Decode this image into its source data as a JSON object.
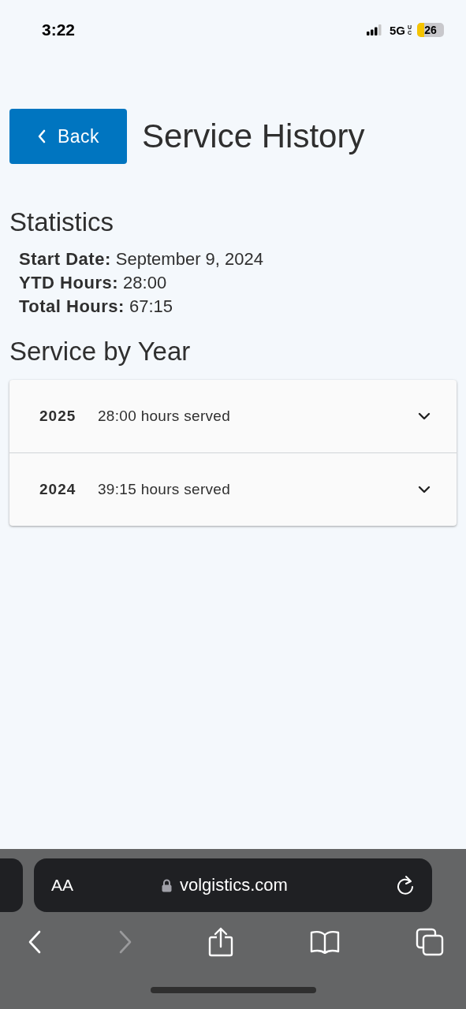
{
  "status_bar": {
    "time": "3:22",
    "network": "5G",
    "network_badge": "UC",
    "battery": "26"
  },
  "header": {
    "back_button": "Back",
    "title": "Service History"
  },
  "statistics": {
    "heading": "Statistics",
    "items": [
      {
        "label": "Start Date:",
        "value": "September 9, 2024"
      },
      {
        "label": "YTD Hours:",
        "value": "28:00"
      },
      {
        "label": "Total Hours:",
        "value": "67:15"
      }
    ]
  },
  "service_by_year": {
    "heading": "Service by Year",
    "rows": [
      {
        "year": "2025",
        "summary": "28:00 hours served",
        "expanded": false
      },
      {
        "year": "2024",
        "summary": "39:15 hours served",
        "expanded": false
      }
    ]
  },
  "browser": {
    "text_size_button": "AA",
    "url": "volgistics.com",
    "back_disabled": false,
    "forward_disabled": true
  }
}
